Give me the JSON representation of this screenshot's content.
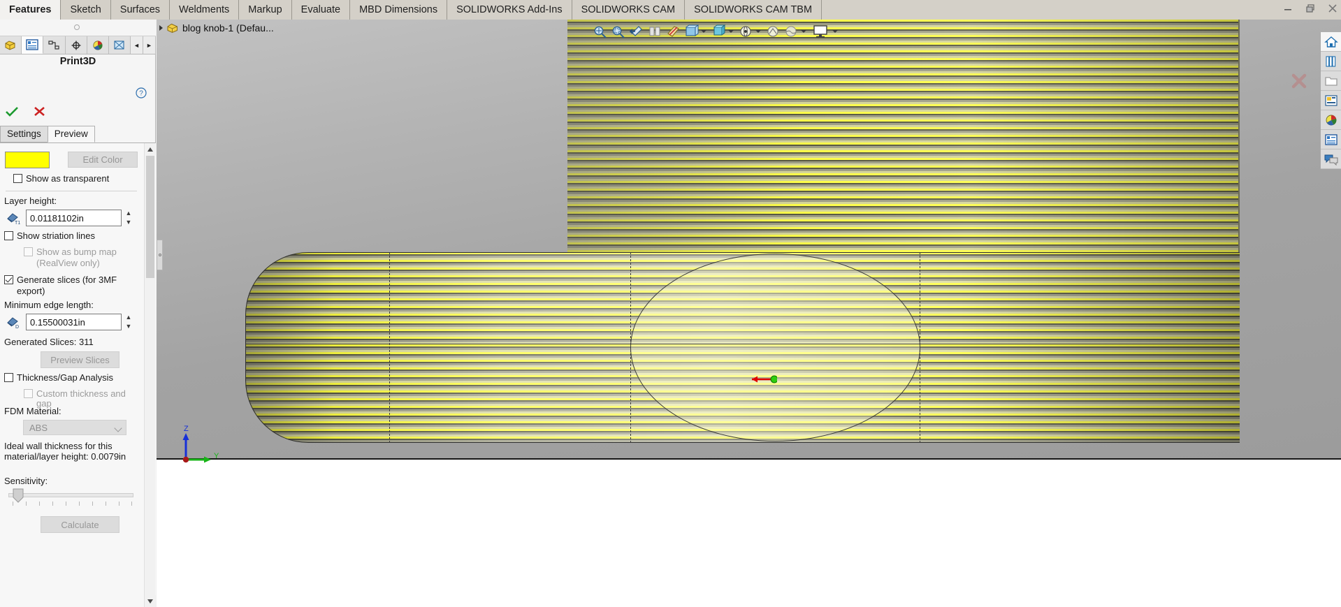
{
  "window": {
    "minimize_label": "Minimize",
    "restore_label": "Restore",
    "close_label": "Close"
  },
  "ribbon": {
    "tabs": [
      {
        "label": "Features",
        "active": true
      },
      {
        "label": "Sketch",
        "active": false
      },
      {
        "label": "Surfaces",
        "active": false
      },
      {
        "label": "Weldments",
        "active": false
      },
      {
        "label": "Markup",
        "active": false
      },
      {
        "label": "Evaluate",
        "active": false
      },
      {
        "label": "MBD Dimensions",
        "active": false
      },
      {
        "label": "SOLIDWORKS Add-Ins",
        "active": false
      },
      {
        "label": "SOLIDWORKS CAM",
        "active": false
      },
      {
        "label": "SOLIDWORKS CAM TBM",
        "active": false
      }
    ]
  },
  "panel": {
    "title": "Print3D",
    "icon_tabs": [
      "feature-manager-tree-icon",
      "property-manager-icon",
      "configuration-manager-icon",
      "dimxpert-manager-icon",
      "display-manager-icon",
      "render-manager-icon"
    ],
    "nav_prev": "◄",
    "nav_next": "►",
    "ok_label": "OK",
    "cancel_label": "Cancel",
    "help_label": "Help",
    "tabs": [
      {
        "label": "Settings",
        "active": false
      },
      {
        "label": "Preview",
        "active": true
      }
    ],
    "preview": {
      "color_swatch_hex": "#ffff00",
      "edit_color_label": "Edit Color",
      "show_as_transparent": {
        "label": "Show as transparent",
        "checked": false,
        "enabled": true
      },
      "layer_height_label": "Layer height:",
      "layer_height_value": "0.01181102in",
      "show_striation_lines": {
        "label": "Show striation lines",
        "checked": false,
        "enabled": true
      },
      "show_as_bump_map": {
        "label": "Show as bump map",
        "label2": "(RealView only)",
        "checked": false,
        "enabled": false
      },
      "generate_slices": {
        "label": "Generate slices (for 3MF",
        "label2": "export)",
        "checked": true,
        "enabled": true
      },
      "minimum_edge_length_label": "Minimum edge length:",
      "minimum_edge_length_value": "0.15500031in",
      "generated_slices_label": "Generated Slices:",
      "generated_slices_value": "311",
      "preview_slices_label": "Preview Slices",
      "thickness_gap_analysis": {
        "label": "Thickness/Gap Analysis",
        "checked": false,
        "enabled": true
      },
      "custom_thickness_and_gap": {
        "label": "Custom thickness and gap",
        "checked": false,
        "enabled": false
      },
      "fdm_material_label": "FDM Material:",
      "fdm_material_value": "ABS",
      "ideal_wall_line1": "Ideal wall thickness for this",
      "ideal_wall_line2": "material/layer height: 0.0079in",
      "sensitivity_label": "Sensitivity:",
      "sensitivity_percent": 8,
      "calculate_label": "Calculate"
    }
  },
  "viewport": {
    "tree_item": "blog knob-1  (Defau...",
    "hud_buttons": [
      "zoom-to-fit-icon",
      "zoom-to-area-icon",
      "previous-view-icon",
      "section-view-icon",
      "view-orientation-icon",
      "display-style-icon",
      "hide-show-items-icon",
      "edit-appearance-icon",
      "apply-scene-icon",
      "view-settings-icon"
    ],
    "triad": {
      "z_label": "Z",
      "y_label": "Y"
    },
    "origin_marker": "origin-arrow"
  },
  "task_pane": {
    "buttons": [
      "solidworks-resources-home-icon",
      "design-library-icon",
      "file-explorer-icon",
      "view-palette-icon",
      "appearances-scenes-decals-icon",
      "custom-properties-icon",
      "solidworks-forum-icon"
    ]
  }
}
